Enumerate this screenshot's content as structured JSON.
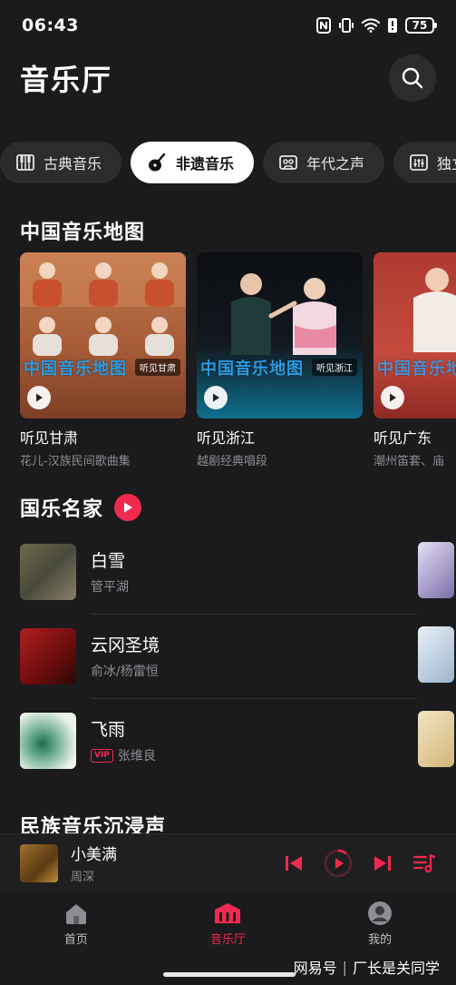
{
  "status_bar": {
    "time": "06:43",
    "battery": "75"
  },
  "header": {
    "title": "音乐厅"
  },
  "chips": [
    {
      "label": "古典音乐",
      "icon": "piano-icon",
      "active": false
    },
    {
      "label": "非遗音乐",
      "icon": "pipa-icon",
      "active": true
    },
    {
      "label": "年代之声",
      "icon": "cassette-icon",
      "active": false
    },
    {
      "label": "独立",
      "icon": "mixer-icon",
      "active": false
    }
  ],
  "map_section": {
    "title": "中国音乐地图",
    "cards": [
      {
        "title": "听见甘肃",
        "subtitle": "花儿-汉族民间歌曲集",
        "cover_text": "中国音乐地图",
        "tag": "听见甘肃"
      },
      {
        "title": "听见浙江",
        "subtitle": "越剧经典唱段",
        "cover_text": "中国音乐地图",
        "tag": "听见浙江"
      },
      {
        "title": "听见广东",
        "subtitle": "潮州笛套、庙",
        "cover_text": "中国音乐地图",
        "tag": ""
      }
    ]
  },
  "masters_section": {
    "title": "国乐名家",
    "songs": [
      {
        "title": "白雪",
        "artist": "管平湖",
        "vip": false
      },
      {
        "title": "云冈圣境",
        "artist": "俞冰/杨雷恒",
        "vip": false
      },
      {
        "title": "飞雨",
        "artist": "张维良",
        "vip": true,
        "vip_label": "VIP"
      }
    ]
  },
  "ethnic_section": {
    "title": "民族音乐沉浸声"
  },
  "mini_player": {
    "title": "小美满",
    "artist": "周深"
  },
  "bottom_nav": [
    {
      "label": "首页",
      "icon": "home-icon",
      "active": false
    },
    {
      "label": "音乐厅",
      "icon": "concert-hall-icon",
      "active": true
    },
    {
      "label": "我的",
      "icon": "profile-icon",
      "active": false
    }
  ],
  "watermark": {
    "left": "网易号",
    "right": "厂长是关同学"
  },
  "colors": {
    "accent": "#f0294f",
    "background": "#1b1b1d"
  }
}
